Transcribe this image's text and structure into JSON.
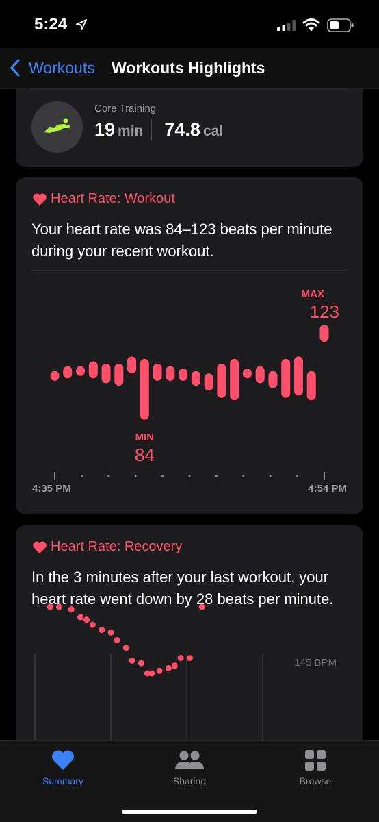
{
  "status_bar": {
    "time": "5:24",
    "icons": [
      "location-arrow-icon",
      "signal-icon",
      "wifi-icon",
      "battery-icon"
    ]
  },
  "nav": {
    "back_label": "Workouts",
    "title": "Workouts Highlights"
  },
  "workout": {
    "type": "Core Training",
    "duration_value": "19",
    "duration_unit": "min",
    "calories_value": "74.8",
    "calories_unit": "cal",
    "icon": "core-training-icon",
    "icon_color": "#b7f03a"
  },
  "heart_rate_card": {
    "header": "Heart Rate: Workout",
    "description": "Your heart rate was 84–123 beats per minute during your recent workout.",
    "accent": "#ff4f6b"
  },
  "recovery_card": {
    "header": "Heart Rate: Recovery",
    "description": "In the 3 minutes after your last workout, your heart rate went down by 28 beats per minute."
  },
  "chart_data": [
    {
      "type": "range_bar",
      "x_start_label": "4:35 PM",
      "x_end_label": "4:54 PM",
      "min_label": "MIN",
      "min_value": "84",
      "max_label": "MAX",
      "max_value": "123",
      "bars": [
        {
          "low": 100,
          "high": 104
        },
        {
          "low": 101,
          "high": 106
        },
        {
          "low": 102,
          "high": 106
        },
        {
          "low": 101,
          "high": 108
        },
        {
          "low": 99,
          "high": 107
        },
        {
          "low": 98,
          "high": 107
        },
        {
          "low": 103,
          "high": 110
        },
        {
          "low": 84,
          "high": 109
        },
        {
          "low": 100,
          "high": 107
        },
        {
          "low": 100,
          "high": 106
        },
        {
          "low": 100,
          "high": 105
        },
        {
          "low": 98,
          "high": 104
        },
        {
          "low": 96,
          "high": 103
        },
        {
          "low": 93,
          "high": 107
        },
        {
          "low": 92,
          "high": 109
        },
        {
          "low": 101,
          "high": 105
        },
        {
          "low": 99,
          "high": 106
        },
        {
          "low": 97,
          "high": 104
        },
        {
          "low": 93,
          "high": 109
        },
        {
          "low": 94,
          "high": 110
        },
        {
          "low": 92,
          "high": 104
        },
        {
          "low": 116,
          "high": 123
        }
      ]
    },
    {
      "type": "scatter",
      "y_top_label": "145 BPM",
      "points": [
        [
          0.05,
          117
        ],
        [
          0.08,
          117
        ],
        [
          0.12,
          118
        ],
        [
          0.15,
          121
        ],
        [
          0.17,
          122
        ],
        [
          0.19,
          124
        ],
        [
          0.22,
          126
        ],
        [
          0.25,
          127
        ],
        [
          0.27,
          130
        ],
        [
          0.3,
          133
        ],
        [
          0.32,
          138
        ],
        [
          0.35,
          139
        ],
        [
          0.37,
          143
        ],
        [
          0.385,
          143
        ],
        [
          0.41,
          142
        ],
        [
          0.44,
          141
        ],
        [
          0.46,
          140
        ],
        [
          0.48,
          137
        ],
        [
          0.51,
          137
        ],
        [
          0.55,
          117
        ]
      ]
    }
  ],
  "tabs": [
    {
      "label": "Summary",
      "icon": "heart-icon",
      "active": true
    },
    {
      "label": "Sharing",
      "icon": "people-icon",
      "active": false
    },
    {
      "label": "Browse",
      "icon": "grid-icon",
      "active": false
    }
  ]
}
